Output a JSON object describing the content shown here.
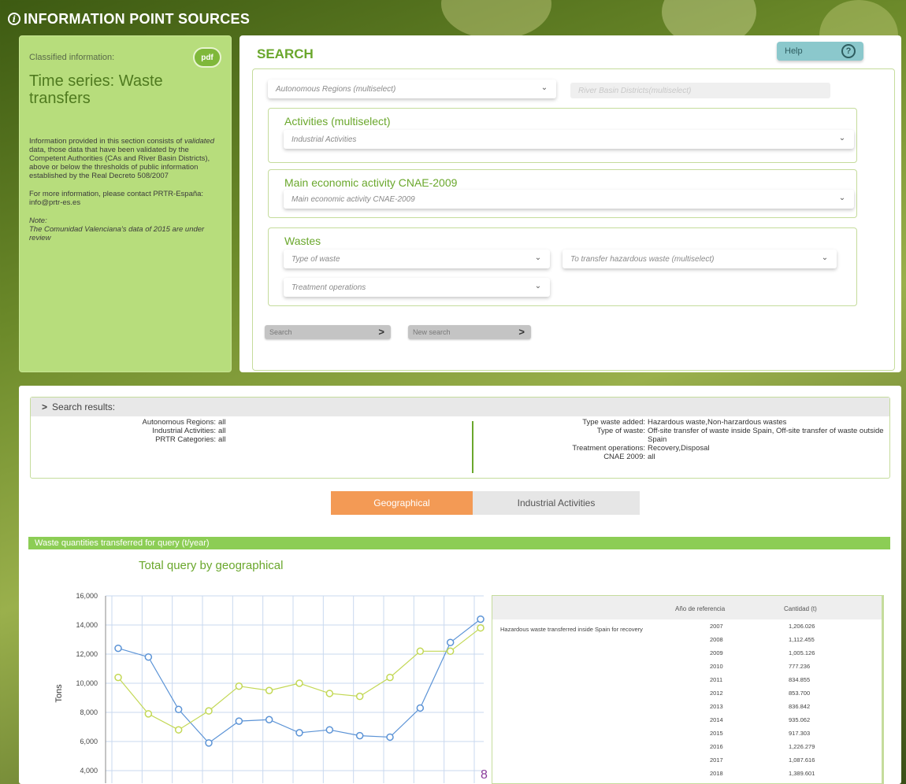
{
  "header": {
    "title": "INFORMATION POINT SOURCES",
    "icon": "info-icon"
  },
  "left_panel": {
    "classified_label": "Classified information:",
    "badge": "pdf",
    "title": "Time series: Waste transfers",
    "para1_a": "Information provided in this section consists of ",
    "para1_em": "validated",
    "para1_b": " data, those data that have been validated by the Competent Authorities (CAs and River Basin Districts), above or below the thresholds of public information established by the Real Decreto 508/2007",
    "para2": "For more information, please contact PRTR-España: info@prtr-es.es",
    "note_label": "Note:",
    "note_text": "The Comunidad Valenciana's data of 2015 are under review"
  },
  "search": {
    "title": "SEARCH",
    "help_label": "Help",
    "autonomous_regions": "Autonomous Regions (multiselect)",
    "river_basin": "River Basin Districts(multiselect)",
    "activities_title": "Activities (multiselect)",
    "activities_placeholder": "Industrial Activities",
    "cnae_title": "Main economic activity CNAE-2009",
    "cnae_placeholder": "Main economic activity CNAE-2009",
    "wastes_title": "Wastes",
    "type_of_waste": "Type of waste",
    "transfer_hazardous": "To transfer hazardous waste (multiselect)",
    "treatment_operations": "Treatment operations",
    "search_button": "Search",
    "new_search_button": "New search"
  },
  "results": {
    "header": "Search results:",
    "left": [
      {
        "k": "Autonomous Regions:",
        "v": "all"
      },
      {
        "k": "Industrial Activities:",
        "v": "all"
      },
      {
        "k": "PRTR Categories:",
        "v": "all"
      }
    ],
    "right": [
      {
        "k": "Type waste added:",
        "v": "Hazardous waste,Non-harzardous wastes"
      },
      {
        "k": "Type of waste:",
        "v": "Off-site transfer of waste inside Spain, Off-site transfer of waste outside Spain"
      },
      {
        "k": "Treatment operations:",
        "v": "Recovery,Disposal"
      },
      {
        "k": "CNAE 2009:",
        "v": "all"
      }
    ],
    "tab_geo": "Geographical",
    "tab_ind": "Industrial Activities",
    "bar_label": "Waste quantities transferred for query (t/year)",
    "chart_title": "Total query by geographical",
    "table": {
      "col_year": "Año de referencia",
      "col_qty": "Cantidad (t)",
      "row_label": "Hazardous waste transferred inside Spain for recovery",
      "years": [
        "2007",
        "2008",
        "2009",
        "2010",
        "2011",
        "2012",
        "2013",
        "2014",
        "2015",
        "2016",
        "2017",
        "2018"
      ],
      "quantities": [
        "1,206.026",
        "1,112.455",
        "1,005.126",
        "777.236",
        "834.855",
        "853.700",
        "836.842",
        "935.062",
        "917.303",
        "1,226.279",
        "1,087.616",
        "1,389.601"
      ]
    }
  },
  "chart_data": {
    "type": "line",
    "ylabel": "Tons",
    "yticks": [
      "16,000",
      "14,000",
      "12,000",
      "10,000",
      "8,000",
      "6,000",
      "4,000"
    ],
    "ylim": [
      4000,
      16000
    ],
    "series": [
      {
        "color": "#5b93d6",
        "values": [
          12400,
          11800,
          8200,
          5900,
          7400,
          7500,
          6600,
          6800,
          6400,
          6300,
          8300,
          12800,
          14400
        ]
      },
      {
        "color": "#c3d855",
        "values": [
          10400,
          7900,
          6800,
          8100,
          9800,
          9500,
          10000,
          9300,
          9100,
          10400,
          12200,
          12200,
          13800
        ]
      }
    ],
    "grid": true,
    "extra_label": "8"
  }
}
